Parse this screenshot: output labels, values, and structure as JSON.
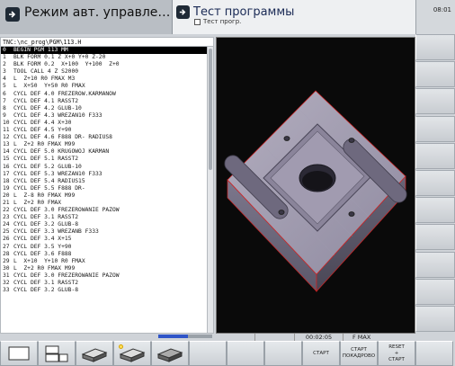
{
  "header": {
    "mode_label": "Режим авт. управле…",
    "program_title": "Тест программы",
    "program_subtitle": "Тест прогр.",
    "clock": "08:01"
  },
  "program": {
    "path": "TNC:\\nc_prog\\PGM\\113.H",
    "lines": [
      {
        "n": "0",
        "cmd": "BEGIN PGM 113 MM",
        "selected": true
      },
      {
        "n": "1",
        "cmd": "BLK FORM 0.1 Z X+0 Y+0 Z-20"
      },
      {
        "n": "2",
        "cmd": "BLK FORM 0.2  X+100  Y+100  Z+0"
      },
      {
        "n": "3",
        "cmd": "TOOL CALL 4 Z S2000"
      },
      {
        "n": "4",
        "cmd": "L  Z+10 R0 FMAX M3"
      },
      {
        "n": "5",
        "cmd": "L  X+50  Y+50 R0 FMAX"
      },
      {
        "n": "6",
        "cmd": "CYCL DEF 4.0 FREZEROW.KARMANOW"
      },
      {
        "n": "7",
        "cmd": "CYCL DEF 4.1 RASST2"
      },
      {
        "n": "8",
        "cmd": "CYCL DEF 4.2 GLUB-10"
      },
      {
        "n": "9",
        "cmd": "CYCL DEF 4.3 WREZAN10 F333"
      },
      {
        "n": "10",
        "cmd": "CYCL DEF 4.4 X+30"
      },
      {
        "n": "11",
        "cmd": "CYCL DEF 4.5 Y+90"
      },
      {
        "n": "12",
        "cmd": "CYCL DEF 4.6 F888 DR- RADIUS8"
      },
      {
        "n": "13",
        "cmd": "L  Z+2 R0 FMAX M99"
      },
      {
        "n": "14",
        "cmd": "CYCL DEF 5.0 KRUGOWOJ KARMAN"
      },
      {
        "n": "15",
        "cmd": "CYCL DEF 5.1 RASST2"
      },
      {
        "n": "16",
        "cmd": "CYCL DEF 5.2 GLUB-10"
      },
      {
        "n": "17",
        "cmd": "CYCL DEF 5.3 WREZAN10 F333"
      },
      {
        "n": "18",
        "cmd": "CYCL DEF 5.4 RADIUS15"
      },
      {
        "n": "19",
        "cmd": "CYCL DEF 5.5 F888 DR-"
      },
      {
        "n": "20",
        "cmd": "L  Z-8 R0 FMAX M99"
      },
      {
        "n": "21",
        "cmd": "L  Z+2 R0 FMAX"
      },
      {
        "n": "22",
        "cmd": "CYCL DEF 3.0 FREZEROWANIE PAZOW"
      },
      {
        "n": "23",
        "cmd": "CYCL DEF 3.1 RASST2"
      },
      {
        "n": "24",
        "cmd": "CYCL DEF 3.2 GLUB-8"
      },
      {
        "n": "25",
        "cmd": "CYCL DEF 3.3 WREZANB F333"
      },
      {
        "n": "26",
        "cmd": "CYCL DEF 3.4 X+15"
      },
      {
        "n": "27",
        "cmd": "CYCL DEF 3.5 Y+90"
      },
      {
        "n": "28",
        "cmd": "CYCL DEF 3.6 F888"
      },
      {
        "n": "29",
        "cmd": "L  X+10  Y+10 R0 FMAX"
      },
      {
        "n": "30",
        "cmd": "L  Z+2 R0 FMAX M99"
      },
      {
        "n": "31",
        "cmd": "CYCL DEF 3.0 FREZEROWANIE PAZOW"
      },
      {
        "n": "32",
        "cmd": "CYCL DEF 3.1 RASST2"
      },
      {
        "n": "33",
        "cmd": "CYCL DEF 3.2 GLUB-8"
      }
    ]
  },
  "status": {
    "time": "00:02:05",
    "feed": "F MAX",
    "progress": 0.55
  },
  "softkeys": {
    "start": "СТАРТ",
    "start_block_1": "СТАРТ",
    "start_block_2": "ПОКАДРОВО",
    "reset_1": "RESET",
    "reset_2": "+",
    "reset_3": "СТАРТ"
  },
  "colors": {
    "selected_line_bg": "#000000",
    "numeric_text": "#3a3fc8",
    "part_edge": "#d22020",
    "progress_fill": "#2f55c8"
  }
}
